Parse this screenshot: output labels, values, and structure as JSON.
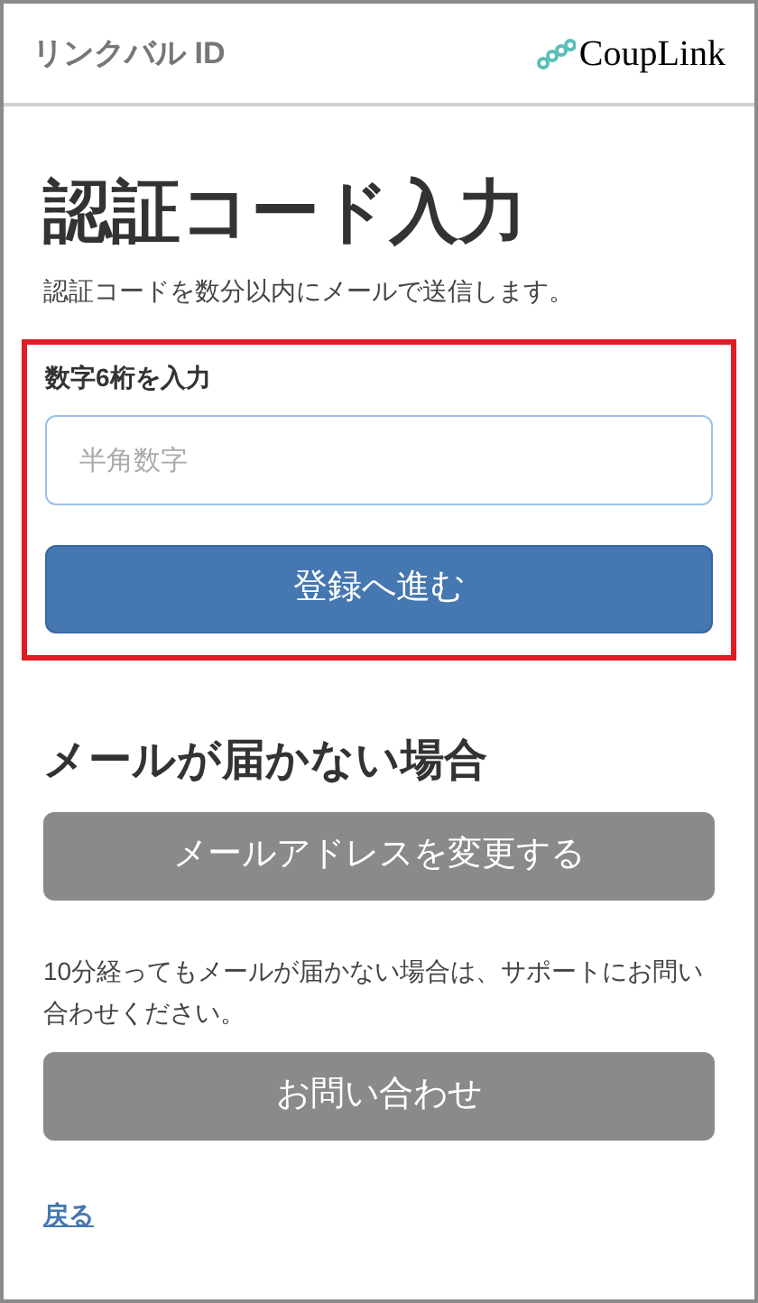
{
  "header": {
    "title": "リンクバル ID",
    "logo_text": "CoupLink"
  },
  "title": "認証コード入力",
  "subtitle": "認証コードを数分以内にメールで送信します。",
  "code_form": {
    "highlighted": true,
    "label": "数字6桁を入力",
    "placeholder": "半角数字",
    "submit": "登録へ進む"
  },
  "not_received": {
    "heading": "メールが届かない場合",
    "change_email_button": "メールアドレスを変更する",
    "note": "10分経ってもメールが届かない場合は、サポートにお問い合わせください。",
    "contact_button": "お問い合わせ"
  },
  "back_link": "戻る"
}
